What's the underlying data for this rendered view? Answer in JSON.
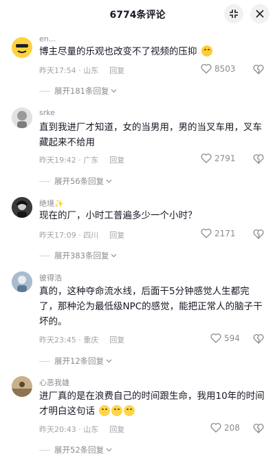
{
  "header": {
    "title": "6774条评论"
  },
  "comments": [
    {
      "username": "en...",
      "text": "博主尽量的乐观也改变不了视频的压抑",
      "time": "昨天17:54 · 山东",
      "reply_label": "回复",
      "likes": "8503",
      "expand_label": "展开181条回复",
      "avatar_color": "#1f1f1f",
      "emojis": [
        "crying-face"
      ]
    },
    {
      "username": "srke",
      "text": "直到我进厂才知道，女的当男用，男的当叉车用，叉车藏起来不给用",
      "time": "昨天19:42 · 广东",
      "reply_label": "回复",
      "likes": "2791",
      "expand_label": "展开56条回复",
      "avatar_color": "#9a9a9a",
      "emojis": []
    },
    {
      "username": "绝境✨",
      "text": "现在的厂，小时工普遍多少一个小时？",
      "time": "昨天17:09 · 四川",
      "reply_label": "回复",
      "likes": "2171",
      "expand_label": "展开383条回复",
      "avatar_color": "#2b2b2b",
      "emojis": []
    },
    {
      "username": "彼得浩",
      "text": "真的，这种夺命流水线，后面干5分钟感觉人生都完了，那种沦为最低级NPC的感觉，能把正常人的脑子干坏的。",
      "time": "昨天23:45 · 重庆",
      "reply_label": "回复",
      "likes": "594",
      "expand_label": "展开12条回复",
      "avatar_color": "#8fa3b8",
      "emojis": []
    },
    {
      "username": "心恶我雄",
      "text": "进厂真的是在浪费自己的时间跟生命，我用10年的时间才明白这句话",
      "time": "昨天20:43 · 山东",
      "reply_label": "回复",
      "likes": "208",
      "expand_label": "展开52条回复",
      "avatar_color": "#b59b7a",
      "emojis": [
        "emoji",
        "emoji",
        "emoji"
      ]
    }
  ]
}
